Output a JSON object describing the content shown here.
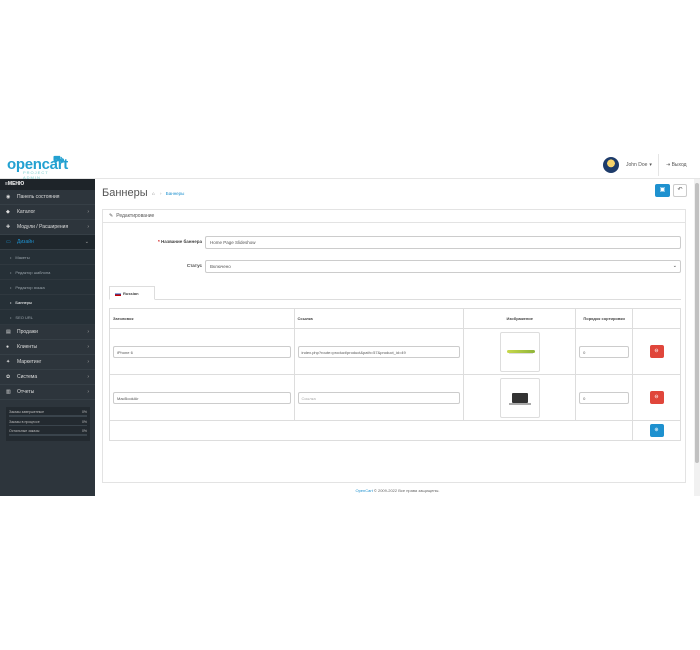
{
  "header": {
    "logo_text": "opencart",
    "logo_sub": "PROJECT ADMIN",
    "user_name": "John Doe",
    "user_caret": "▾",
    "logout_label": "Выход"
  },
  "sidebar": {
    "menu_title": "МЕНЮ",
    "items": [
      {
        "label": "Панель состояния",
        "icon": "dashboard-icon",
        "glyph": "◉"
      },
      {
        "label": "Каталог",
        "icon": "tag-icon",
        "glyph": "◆"
      },
      {
        "label": "Модули / Расширения",
        "icon": "puzzle-icon",
        "glyph": "✚"
      },
      {
        "label": "Дизайн",
        "icon": "monitor-icon",
        "glyph": "▭"
      }
    ],
    "design_sub": [
      {
        "label": "Макеты"
      },
      {
        "label": "Редактор шаблона"
      },
      {
        "label": "Редактор языка"
      },
      {
        "label": "Баннеры"
      },
      {
        "label": "SEO URL"
      }
    ],
    "items2": [
      {
        "label": "Продажи",
        "icon": "cart-icon",
        "glyph": "▤"
      },
      {
        "label": "Клиенты",
        "icon": "user-icon",
        "glyph": "●"
      },
      {
        "label": "Маркетинг",
        "icon": "share-icon",
        "glyph": "✦"
      },
      {
        "label": "Система",
        "icon": "gear-icon",
        "glyph": "✿"
      },
      {
        "label": "Отчеты",
        "icon": "chart-icon",
        "glyph": "▥"
      }
    ],
    "stats": [
      {
        "label": "Заказы завершенные",
        "pct": "0%"
      },
      {
        "label": "Заказы в процессе",
        "pct": "0%"
      },
      {
        "label": "Остальные заказы",
        "pct": "0%"
      }
    ]
  },
  "main": {
    "title": "Баннеры",
    "breadcrumb": "Баннеры",
    "panel_title": "Редактирование",
    "form": {
      "name_label": "Название баннера",
      "name_value": "Home Page Slideshow",
      "status_label": "Статус",
      "status_value": "Включено"
    },
    "tab_label": "Russian",
    "table": {
      "headers": [
        "Заголовок",
        "Ссылка",
        "Изображение",
        "Порядок сортировки"
      ],
      "rows": [
        {
          "title": "iPhone 6",
          "link": "index.php?route=product/product&path=57&product_id=49",
          "image": "iphone",
          "sort": "0"
        },
        {
          "title": "MacBookAir",
          "link": "",
          "link_placeholder": "Ссылка",
          "image": "macbook",
          "sort": "0"
        }
      ]
    }
  },
  "footer": {
    "link": "OpenCart",
    "text": " © 2009-2022 Все права защищены."
  }
}
